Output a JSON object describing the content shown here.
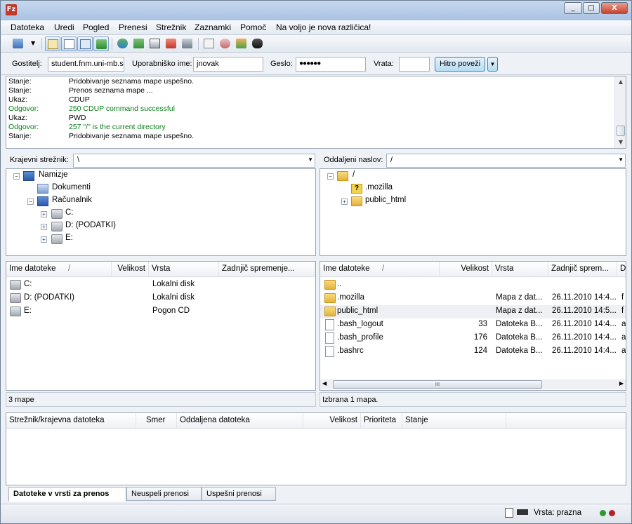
{
  "window": {
    "title_icon": "Fz",
    "buttons": [
      "_",
      "□",
      "X"
    ]
  },
  "menu": [
    "Datoteka",
    "Uredi",
    "Pogled",
    "Prenesi",
    "Strežnik",
    "Zaznamki",
    "Pomoč",
    "Na voljo je nova različica!"
  ],
  "toolbar": {
    "icons": [
      "site-manager-icon",
      "site-manager-dropdown-icon",
      "toggle-log-icon",
      "toggle-local-tree-icon",
      "toggle-remote-tree-icon",
      "toggle-queue-icon",
      "refresh-icon",
      "process-queue-icon",
      "cancel-icon",
      "disconnect-icon",
      "reconnect-icon",
      "directory-listing-filter-icon",
      "toggle-sync-browsing-icon",
      "compare-icon",
      "search-icon"
    ]
  },
  "quickconnect": {
    "host_label": "Gostitelj:",
    "host_value": "student.fnm.uni-mb.s",
    "user_label": "Uporabniško ime:",
    "user_value": "jnovak",
    "pass_label": "Geslo:",
    "pass_value": "●●●●●●",
    "port_label": "Vrata:",
    "port_value": "",
    "connect_label": "Hitro poveži",
    "dropdown_glyph": "▼"
  },
  "log": [
    {
      "key": "Stanje:",
      "value": "Pridobivanje seznama mape uspešno.",
      "color": "#000000"
    },
    {
      "key": "Stanje:",
      "value": "Prenos seznama mape ...",
      "color": "#000000"
    },
    {
      "key": "Ukaz:",
      "value": "CDUP",
      "color": "#000000"
    },
    {
      "key": "Odgovor:",
      "value": "250 CDUP command successful",
      "color": "#0a7f1b"
    },
    {
      "key": "Ukaz:",
      "value": "PWD",
      "color": "#000000"
    },
    {
      "key": "Odgovor:",
      "value": "257 \"/\" is the current directory",
      "color": "#0a7f1b"
    },
    {
      "key": "Stanje:",
      "value": "Pridobivanje seznama mape uspešno.",
      "color": "#000000"
    }
  ],
  "local": {
    "addr_label": "Krajevni strežnik:",
    "addr_value": "\\",
    "tree": [
      {
        "label": "Namizje",
        "icon": "desktop-icon",
        "expander": "−"
      },
      {
        "label": "Dokumenti",
        "icon": "documents-icon",
        "expander": ""
      },
      {
        "label": "Računalnik",
        "icon": "computer-icon",
        "expander": "−"
      },
      {
        "label": "C:",
        "icon": "drive-c-icon",
        "expander": "+"
      },
      {
        "label": "D: (PODATKI)",
        "icon": "drive-d-icon",
        "expander": "+"
      },
      {
        "label": "E:",
        "icon": "cd-drive-icon",
        "expander": "+"
      }
    ],
    "columns": [
      "Ime datoteke",
      "/",
      "Velikost",
      "Vrsta",
      "Zadnjič spremenje..."
    ],
    "files": [
      {
        "name": "C:",
        "size": "",
        "type": "Lokalni disk",
        "modified": "",
        "icon": "drive-c-icon"
      },
      {
        "name": "D: (PODATKI)",
        "size": "",
        "type": "Lokalni disk",
        "modified": "",
        "icon": "drive-d-icon"
      },
      {
        "name": "E:",
        "size": "",
        "type": "Pogon CD",
        "modified": "",
        "icon": "cd-drive-icon"
      }
    ],
    "status": "3 mape"
  },
  "remote": {
    "addr_label": "Oddaljeni naslov:",
    "addr_value": "/",
    "tree": [
      {
        "label": "/",
        "icon": "folder-icon",
        "expander": "−"
      },
      {
        "label": ".mozilla",
        "icon": "unknown-folder-icon",
        "expander": ""
      },
      {
        "label": "public_html",
        "icon": "folder-icon",
        "expander": "+"
      }
    ],
    "columns": [
      "Ime datoteke",
      "/",
      "Velikost",
      "Vrsta",
      "Zadnjič sprem...",
      "D"
    ],
    "files": [
      {
        "name": "..",
        "size": "",
        "type": "",
        "modified": "",
        "perm": "",
        "icon": "folder-icon"
      },
      {
        "name": ".mozilla",
        "size": "",
        "type": "Mapa z dat...",
        "modified": "26.11.2010 14:4...",
        "perm": "f",
        "icon": "folder-icon"
      },
      {
        "name": "public_html",
        "size": "",
        "type": "Mapa z dat...",
        "modified": "26.11.2010 14:5...",
        "perm": "f",
        "icon": "folder-icon"
      },
      {
        "name": ".bash_logout",
        "size": "33",
        "type": "Datoteka B...",
        "modified": "26.11.2010 14:4...",
        "perm": "a",
        "icon": "file-icon"
      },
      {
        "name": ".bash_profile",
        "size": "176",
        "type": "Datoteka B...",
        "modified": "26.11.2010 14:4...",
        "perm": "a",
        "icon": "file-icon"
      },
      {
        "name": ".bashrc",
        "size": "124",
        "type": "Datoteka B...",
        "modified": "26.11.2010 14:4...",
        "perm": "a",
        "icon": "file-icon"
      }
    ],
    "hscroll_grip": "III",
    "status": "Izbrana 1 mapa."
  },
  "queue": {
    "columns": [
      "Strežnik/krajevna datoteka",
      "Smer",
      "Oddaljena datoteka",
      "Velikost",
      "Prioriteta",
      "Stanje"
    ],
    "tabs": [
      "Datoteke v vrsti za prenos",
      "Neuspeli prenosi",
      "Uspešni prenosi"
    ]
  },
  "statusbar": {
    "queue_label": "Vrsta: prazna",
    "led_colors": [
      "#2e9a2e",
      "#b22222"
    ]
  }
}
